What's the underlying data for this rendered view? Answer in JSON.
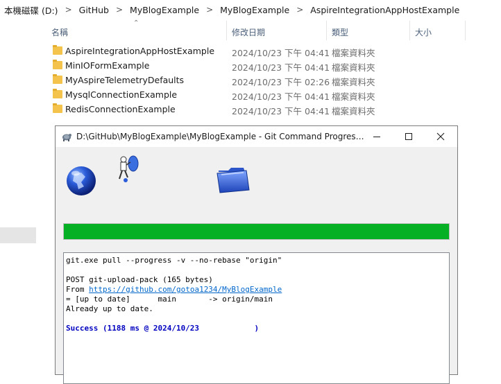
{
  "breadcrumb": {
    "items": [
      "本機磁碟 (D:)",
      "GitHub",
      "MyBlogExample",
      "MyBlogExample",
      "AspireIntegrationAppHostExample"
    ],
    "separator": ">"
  },
  "columns": {
    "name": "名稱",
    "modified": "修改日期",
    "type": "類型",
    "size": "大小"
  },
  "files": [
    {
      "name": "AspireIntegrationAppHostExample",
      "date": "2024/10/23 下午 04:41",
      "type": "檔案資料夾"
    },
    {
      "name": "MinIOFormExample",
      "date": "2024/10/23 下午 04:41",
      "type": "檔案資料夾"
    },
    {
      "name": "MyAspireTelemetryDefaults",
      "date": "2024/10/23 下午 02:26",
      "type": "檔案資料夾"
    },
    {
      "name": "MysqlConnectionExample",
      "date": "2024/10/23 下午 04:41",
      "type": "檔案資料夾"
    },
    {
      "name": "RedisConnectionExample",
      "date": "2024/10/23 下午 04:41",
      "type": "檔案資料夾"
    }
  ],
  "dialog": {
    "title": "D:\\GitHub\\MyBlogExample\\MyBlogExample - Git Command Progress - TortoiseGit",
    "progress_percent": 100,
    "progress_color": "#06b025",
    "log": {
      "command": "git.exe pull --progress -v --no-rebase \"origin\"",
      "blank1": "",
      "post": "POST git-upload-pack (165 bytes)",
      "from_label": "From ",
      "from_url": "https://github.com/gotoa1234/MyBlogExample",
      "up_to_date": "= [up to date]      main       -> origin/main",
      "already": "Already up to date.",
      "blank2": "",
      "success": "Success (1188 ms @ 2024/10/23            )"
    }
  },
  "colors": {
    "folder": "#f3c34b",
    "link": "#0066cc",
    "success": "#0000c0"
  }
}
